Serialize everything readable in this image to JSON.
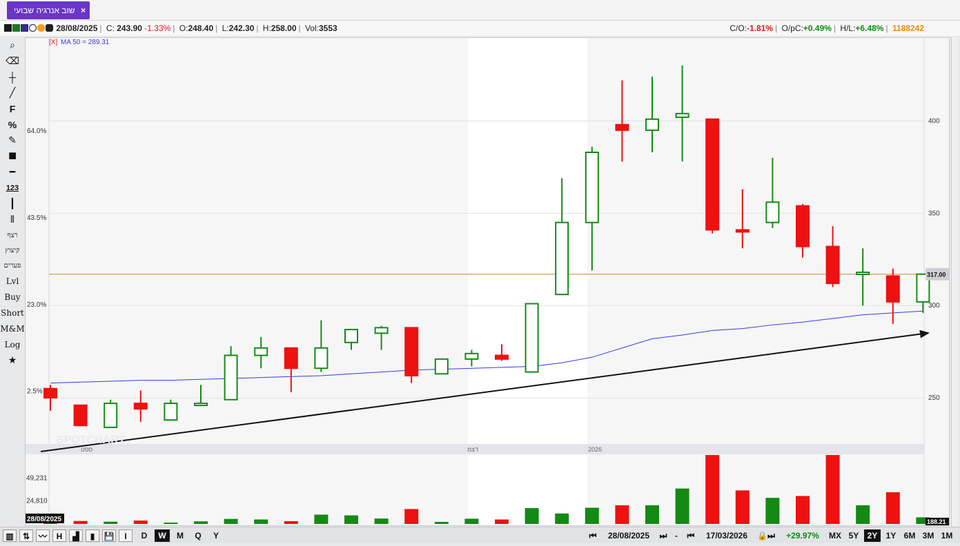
{
  "tab": {
    "title": "שוב אנרגיה שבועי",
    "close": "×"
  },
  "info": {
    "date": "28/08/2025",
    "c_label": "C:",
    "c_value": "243.90",
    "c_change": "-1.33%",
    "o_label": "O:",
    "o_value": "248.40",
    "l_label": "L:",
    "l_value": "242.30",
    "h_label": "H:",
    "h_value": "258.00",
    "vol_label": "Vol:",
    "vol_value": "3553",
    "co_label": "C/O:",
    "co_value": "-1.81%",
    "opc_label": "O/pC:",
    "opc_value": "+0.49%",
    "hl_label": "H/L:",
    "hl_value": "+6.48%",
    "id": "1188242"
  },
  "toolbar": {
    "search_icon": "⌕",
    "eraser_icon": "⌫",
    "crosshair_icon": "┼",
    "line_icon": "╱",
    "fib_label": "F",
    "percent_label": "%",
    "edit_icon": "✎",
    "color_icon": "■",
    "hline_icon": "━",
    "count_label": "123",
    "vline_icon": "┃",
    "candles_icon": "⫴",
    "heb1": "רצף",
    "heb2": "קיצוץ",
    "heb3": "פערים",
    "lvl": "Lvl",
    "buy": "Buy",
    "short": "Short",
    "mm": "M&M",
    "log": "Log",
    "star_icon": "★"
  },
  "legend": {
    "remove": "[X]",
    "ma_label": "MA 50 = 289.31"
  },
  "colors": {
    "up": "#138a13",
    "down": "#ee1111",
    "ma": "#3838e0",
    "trend": "#111111",
    "level": "#c78a2a",
    "tab": "#6a35c9"
  },
  "price_axis": {
    "ticks": [
      "250",
      "300",
      "350",
      "400"
    ],
    "current": "317.00",
    "bottom": "188.21"
  },
  "percent_axis": {
    "ticks": [
      "2.5%",
      "23.0%",
      "43.5%",
      "64.0%"
    ]
  },
  "volume_axis": {
    "ticks": [
      "24,810",
      "49,231"
    ]
  },
  "time_axis": {
    "labels": [
      "ספט",
      "דצמ",
      "2026"
    ],
    "cursor_date": "28/08/2025"
  },
  "watermark": "SPOTCHART",
  "bottom": {
    "tools": [
      "▥",
      "⇅",
      "〰",
      "H",
      "▟",
      "▮",
      "💾",
      "I"
    ],
    "periods": [
      "D",
      "W",
      "M",
      "Q",
      "Y"
    ],
    "active_period": "W",
    "from_date": "28/08/2025",
    "dash": "-",
    "to_date": "17/03/2026",
    "change": "+29.97%",
    "ranges": [
      "MX",
      "5Y",
      "2Y",
      "1Y",
      "6M",
      "3M",
      "1M"
    ],
    "active_range": "2Y"
  },
  "chart_data": {
    "type": "candlestick",
    "y_unit": "price",
    "ylim": [
      225,
      445
    ],
    "candles": [
      {
        "o": 255,
        "h": 257,
        "l": 243,
        "c": 250,
        "v": 1200
      },
      {
        "o": 246,
        "h": 246,
        "l": 235,
        "c": 235,
        "v": 1600
      },
      {
        "o": 234,
        "h": 249,
        "l": 234,
        "c": 247,
        "v": 1200
      },
      {
        "o": 247,
        "h": 254,
        "l": 237,
        "c": 244,
        "v": 1800
      },
      {
        "o": 238,
        "h": 249,
        "l": 238,
        "c": 247,
        "v": 600
      },
      {
        "o": 246,
        "h": 257,
        "l": 246,
        "c": 247,
        "v": 1400
      },
      {
        "o": 249,
        "h": 278,
        "l": 249,
        "c": 273,
        "v": 2700
      },
      {
        "o": 273,
        "h": 283,
        "l": 266,
        "c": 277,
        "v": 2400
      },
      {
        "o": 277,
        "h": 277,
        "l": 253,
        "c": 266,
        "v": 1500
      },
      {
        "o": 266,
        "h": 292,
        "l": 264,
        "c": 277,
        "v": 5000
      },
      {
        "o": 280,
        "h": 286,
        "l": 276,
        "c": 287,
        "v": 4600
      },
      {
        "o": 285,
        "h": 289,
        "l": 276,
        "c": 288,
        "v": 2900
      },
      {
        "o": 288,
        "h": 288,
        "l": 258,
        "c": 262,
        "v": 8000
      },
      {
        "o": 263,
        "h": 264,
        "l": 263,
        "c": 271,
        "v": 1100
      },
      {
        "o": 271,
        "h": 276,
        "l": 267,
        "c": 274,
        "v": 2800
      },
      {
        "o": 273,
        "h": 279,
        "l": 270,
        "c": 271,
        "v": 2400
      },
      {
        "o": 264,
        "h": 301,
        "l": 264,
        "c": 301,
        "v": 8500
      },
      {
        "o": 306,
        "h": 369,
        "l": 306,
        "c": 345,
        "v": 5600
      },
      {
        "o": 345,
        "h": 386,
        "l": 319,
        "c": 383,
        "v": 8700
      },
      {
        "o": 398,
        "h": 422,
        "l": 378,
        "c": 395,
        "v": 10000
      },
      {
        "o": 395,
        "h": 424,
        "l": 383,
        "c": 401,
        "v": 10000
      },
      {
        "o": 402,
        "h": 430,
        "l": 378,
        "c": 404,
        "v": 19000
      },
      {
        "o": 401,
        "h": 401,
        "l": 339,
        "c": 341,
        "v": 37000
      },
      {
        "o": 341,
        "h": 363,
        "l": 331,
        "c": 340,
        "v": 18000
      },
      {
        "o": 345,
        "h": 380,
        "l": 342,
        "c": 356,
        "v": 14000
      },
      {
        "o": 354,
        "h": 355,
        "l": 326,
        "c": 332,
        "v": 15000
      },
      {
        "o": 332,
        "h": 343,
        "l": 310,
        "c": 312,
        "v": 37000
      },
      {
        "o": 318,
        "h": 331,
        "l": 300,
        "c": 318,
        "v": 10000
      },
      {
        "o": 316,
        "h": 320,
        "l": 290,
        "c": 302,
        "v": 17000
      },
      {
        "o": 302,
        "h": 317,
        "l": 296,
        "c": 317,
        "v": 3553
      }
    ],
    "ma50": [
      258,
      258.5,
      259,
      259.5,
      259.5,
      260,
      260.5,
      261,
      261.5,
      262,
      263,
      264,
      265,
      265.5,
      266,
      266.5,
      267,
      269,
      272,
      277,
      282,
      284,
      286.5,
      287.5,
      289.5,
      291,
      293,
      295,
      296,
      297
    ],
    "horizontal_level": 317,
    "volume_ylim": [
      0,
      37000
    ]
  }
}
